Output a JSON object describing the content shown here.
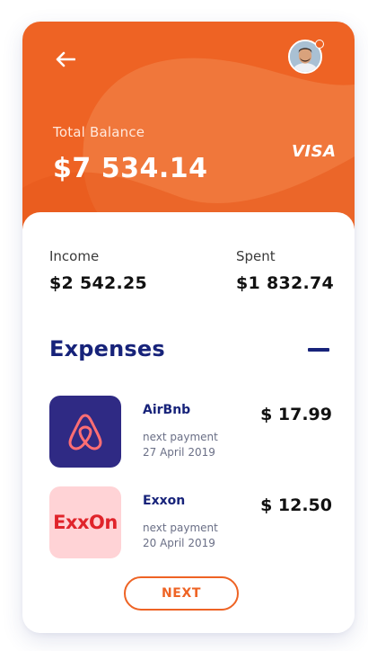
{
  "header": {
    "balance_label": "Total Balance",
    "balance_value": "$7 534.14",
    "card_brand": "VISA",
    "accent_color": "#ee6324"
  },
  "stats": {
    "income_label": "Income",
    "income_value": "$2 542.25",
    "spent_label": "Spent",
    "spent_value": "$1 832.74"
  },
  "expenses": {
    "title": "Expenses",
    "items": [
      {
        "name": "AirBnb",
        "sub_label": "next payment",
        "date": "27 April 2019",
        "amount": "$ 17.99",
        "icon": "airbnb-logo"
      },
      {
        "name": "Exxon",
        "logo_text": "ExxOn",
        "sub_label": "next payment",
        "date": "20 April 2019",
        "amount": "$ 12.50",
        "icon": "exxon-logo"
      }
    ]
  },
  "footer": {
    "next_label": "NEXT"
  }
}
